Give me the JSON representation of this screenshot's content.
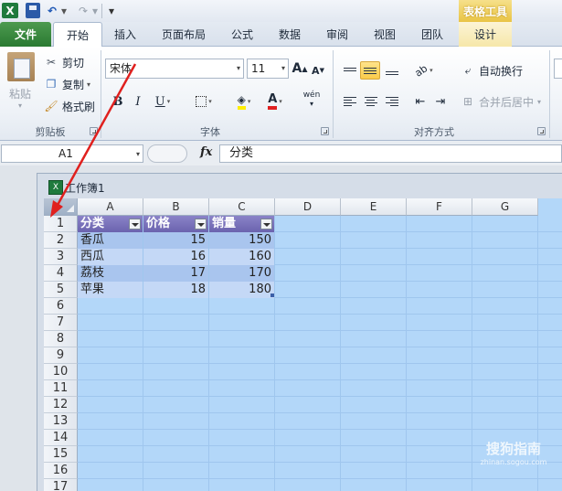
{
  "quick_access": {
    "more_label": "▾"
  },
  "context_tool": "表格工具",
  "tabs": [
    {
      "label": "文件"
    },
    {
      "label": "开始"
    },
    {
      "label": "插入"
    },
    {
      "label": "页面布局"
    },
    {
      "label": "公式"
    },
    {
      "label": "数据"
    },
    {
      "label": "审阅"
    },
    {
      "label": "视图"
    },
    {
      "label": "团队"
    },
    {
      "label": "设计"
    }
  ],
  "clipboard": {
    "paste": "粘贴",
    "cut": "剪切",
    "copy": "复制",
    "format_painter": "格式刷",
    "group": "剪贴板"
  },
  "font": {
    "name": "宋体",
    "size": "11",
    "grow": "A",
    "shrink": "A",
    "bold": "B",
    "italic": "I",
    "underline": "U",
    "font_color_glyph": "A",
    "phonetic": "wén",
    "group": "字体"
  },
  "alignment": {
    "wrap_text": "自动换行",
    "merge_center": "合并后居中",
    "group": "对齐方式"
  },
  "formula_bar": {
    "name_box": "A1",
    "fx": "fx",
    "content": "分类"
  },
  "workbook": {
    "title": "工作簿1",
    "columns": [
      "A",
      "B",
      "C",
      "D",
      "E",
      "F",
      "G"
    ],
    "rows": [
      "1",
      "2",
      "3",
      "4",
      "5",
      "6",
      "7",
      "8",
      "9",
      "10",
      "11",
      "12",
      "13",
      "14",
      "15",
      "16",
      "17"
    ],
    "table": {
      "headers": [
        "分类",
        "价格",
        "销量"
      ],
      "data": [
        [
          "香瓜",
          "15",
          "150"
        ],
        [
          "西瓜",
          "16",
          "160"
        ],
        [
          "荔枝",
          "17",
          "170"
        ],
        [
          "苹果",
          "18",
          "180"
        ]
      ]
    }
  },
  "watermark": {
    "main": "搜狗指南",
    "sub": "zhinan.sogou.com"
  },
  "colors": {
    "table_header": "#6b63ae",
    "selection": "#b3d7f9",
    "annotation_arrow": "#e0201e",
    "file_tab": "#2a7a32"
  }
}
